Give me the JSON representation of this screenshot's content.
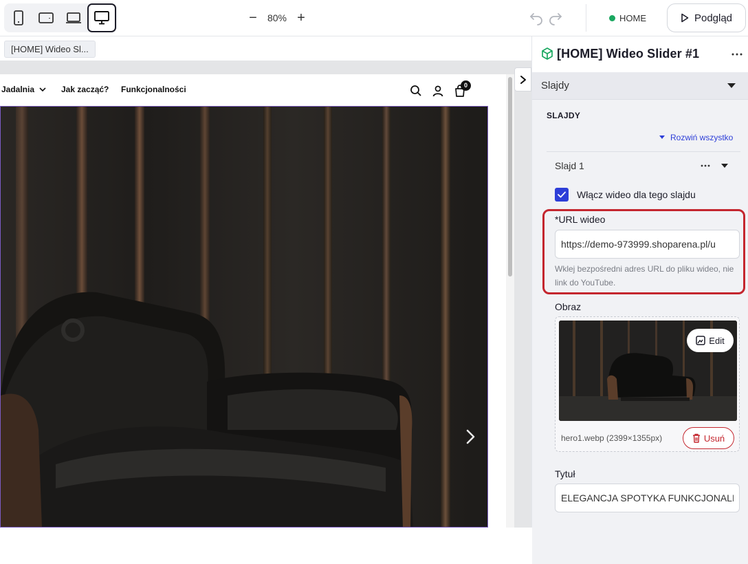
{
  "toolbar": {
    "devices": [
      "phone-icon",
      "tablet-icon",
      "laptop-icon",
      "desktop-icon"
    ],
    "zoom_minus": "−",
    "zoom_value": "80%",
    "zoom_plus": "+",
    "status_label": "HOME",
    "status_color": "#1aa760",
    "preview_label": "Podgląd"
  },
  "breadcrumb": {
    "label": "[HOME] Wideo Sl..."
  },
  "site_nav": {
    "items": [
      "Jadalnia",
      "Jak zacząć?",
      "Funkcjonalności"
    ],
    "cart_count": "0"
  },
  "panel": {
    "title": "[HOME] Wideo Slider #1",
    "accordion_label": "Slajdy",
    "section_label": "SLAJDY",
    "expand_all": "Rozwiń wszystko",
    "slide_label": "Slajd 1",
    "video_checkbox_label": "Włącz wideo dla tego slajdu",
    "video_checked": true,
    "url_label": "*URL wideo",
    "url_value": "https://demo-973999.shoparena.pl/u",
    "url_hint": "Wklej bezpośredni adres URL do pliku wideo, nie link do YouTube.",
    "image_label": "Obraz",
    "edit_label": "Edit",
    "file_name": "hero1.webp (2399×1355px)",
    "delete_label": "Usuń",
    "title_label": "Tytuł",
    "title_value": "ELEGANCJA SPOTYKA FUNKCJONALN"
  },
  "colors": {
    "accent": "#2d3ed8",
    "danger": "#c4262e",
    "selection": "#7b5cc4"
  }
}
